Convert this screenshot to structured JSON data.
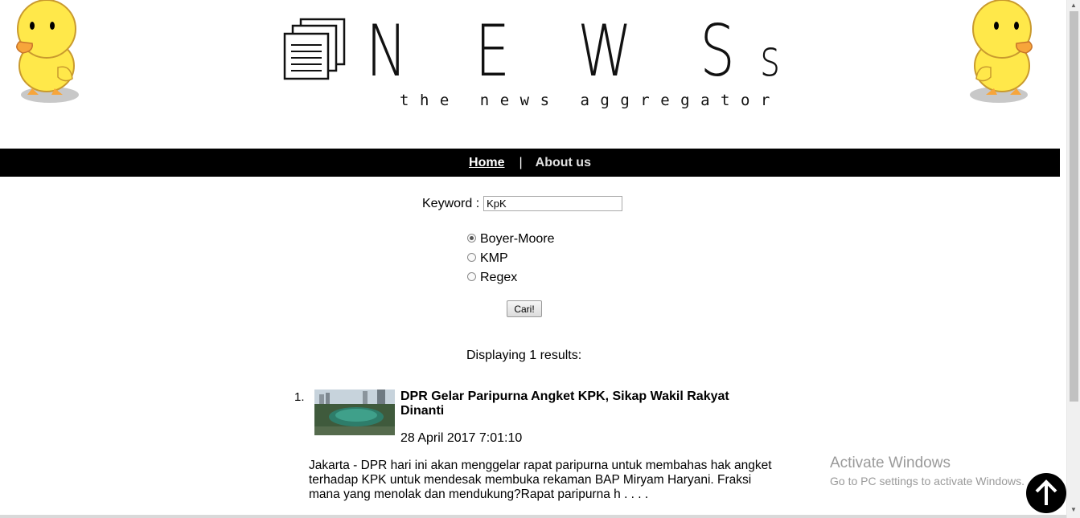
{
  "logo": {
    "big_letters": "N E W S",
    "small_letter": "s",
    "tagline": "the news aggregator"
  },
  "nav": {
    "home": "Home",
    "separator": "|",
    "about": "About us"
  },
  "search": {
    "keyword_label": "Keyword :",
    "keyword_value": "KpK",
    "algorithms": [
      "Boyer-Moore",
      "KMP",
      "Regex"
    ],
    "selected": "Boyer-Moore",
    "submit_label": "Cari!"
  },
  "results": {
    "count_text": "Displaying 1 results:",
    "items": [
      {
        "number": "1.",
        "title": "DPR Gelar Paripurna Angket KPK, Sikap Wakil Rakyat Dinanti",
        "date": "28 April 2017 7:01:10",
        "snippet": "Jakarta - DPR hari ini akan menggelar rapat paripurna untuk membahas hak angket terhadap KPK untuk mendesak membuka rekaman BAP Miryam Haryani. Fraksi mana yang menolak dan mendukung?Rapat paripurna h . . . ."
      }
    ]
  },
  "watermark": {
    "line1": "Activate Windows",
    "line2": "Go to PC settings to activate Windows."
  },
  "colors": {
    "navbar_bg": "#000000",
    "duck": "#ffe84a",
    "page_bg": "#ffffff"
  },
  "icons": {
    "back_to_top": "arrow-up-icon",
    "logo": "documents-stack-icon",
    "mascot": "duck-mascot-icon"
  }
}
